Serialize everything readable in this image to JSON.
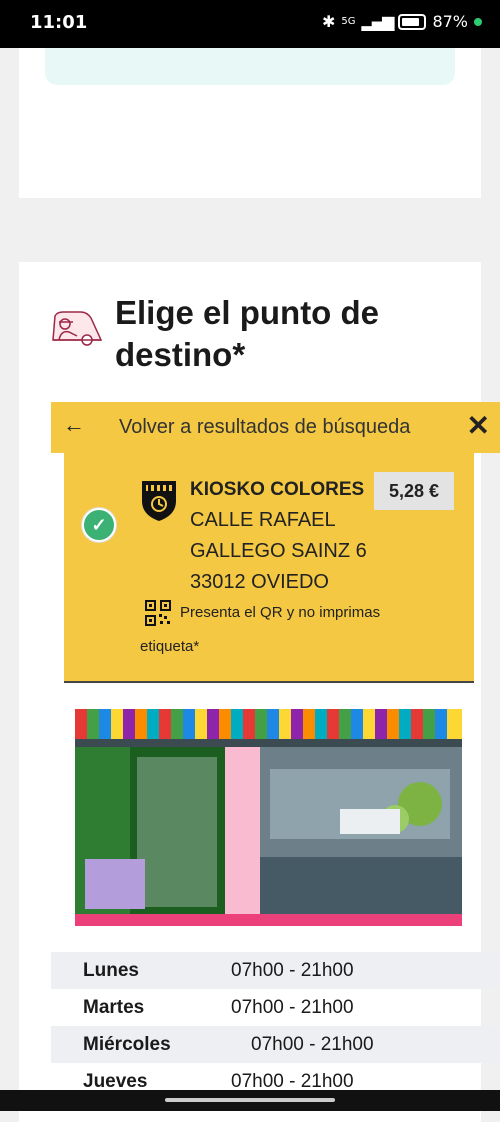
{
  "status": {
    "time": "11:01",
    "network": "5G",
    "battery": "87%"
  },
  "section": {
    "title": "Elige el punto de destino*"
  },
  "back_bar": {
    "label": "Volver a resultados de búsqueda"
  },
  "point": {
    "name": "KIOSKO COLORES",
    "price": "5,28 €",
    "address_lines": [
      "CALLE RAFAEL",
      "GALLEGO SAINZ 6",
      "33012 OVIEDO"
    ],
    "qr_note_1": "Presenta el QR y no imprimas",
    "qr_note_2": "etiqueta*"
  },
  "hours": [
    {
      "day": "Lunes",
      "time": "07h00 - 21h00"
    },
    {
      "day": "Martes",
      "time": "07h00 - 21h00"
    },
    {
      "day": "Miércoles",
      "time": "07h00 - 21h00"
    },
    {
      "day": "Jueves",
      "time": "07h00 - 21h00"
    }
  ],
  "colors": {
    "accent": "#f4c842",
    "check": "#3bb273",
    "teal": "#e8f8f6"
  },
  "icons": {
    "back": "arrow-left-icon",
    "close": "close-icon",
    "selected": "check-icon",
    "qr": "qr-code-icon"
  }
}
